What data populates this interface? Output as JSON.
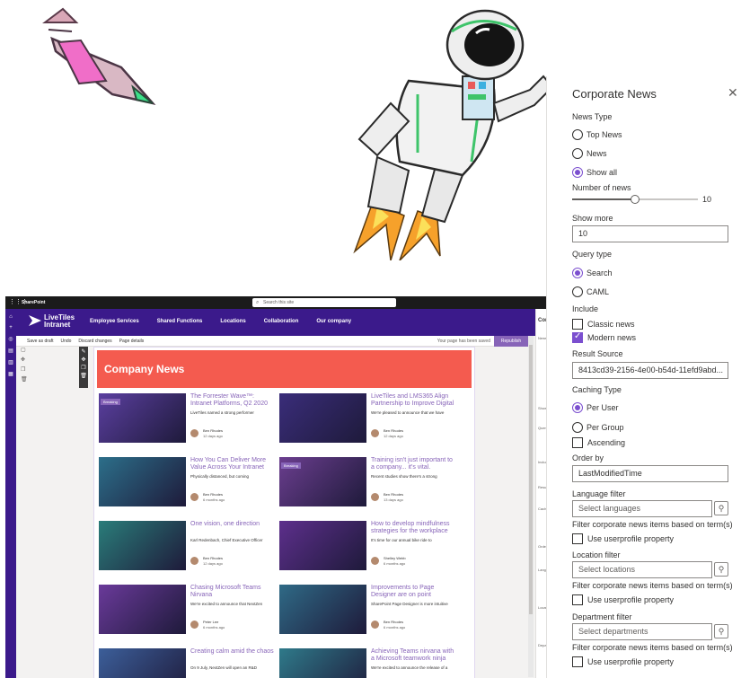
{
  "sharepoint": {
    "suite_brand": "SharePoint",
    "search_placeholder": "Search this site",
    "logo_text": "LiveTiles Intranet",
    "nav_items": [
      "Employee Services",
      "Shared Functions",
      "Locations",
      "Collaboration",
      "Our company"
    ],
    "command_bar": {
      "save_as_draft": "Save as draft",
      "undo": "Undo",
      "discard_changes": "Discard changes",
      "page_details": "Page details",
      "saved_status": "Your page has been saved",
      "republish": "Republish"
    },
    "news_heading": "Company News",
    "badge_breaking": "Breaking",
    "cards": [
      {
        "title": "The Forrester Wave™: Intranet Platforms, Q2 2020",
        "excerpt": "LiveTiles named a strong performer",
        "author": "Ben Rhodes",
        "date": "12 days ago",
        "breaking": true
      },
      {
        "title": "LiveTiles and LMS365 Align Partnership to Improve Digital",
        "excerpt": "We're pleased to announce that we have",
        "author": "Ben Rhodes",
        "date": "12 days ago",
        "breaking": false
      },
      {
        "title": "How You Can Deliver More Value Across Your Intranet",
        "excerpt": "Physically distanced, but coming",
        "author": "Ben Rhodes",
        "date": "6 months ago",
        "breaking": false
      },
      {
        "title": "Training isn't just important to a company... it's vital.",
        "excerpt": "Recent studies show there's a strong",
        "author": "Ben Rhodes",
        "date": "13 days ago",
        "breaking": true
      },
      {
        "title": "One vision, one direction",
        "excerpt": "Karl Redenbach, Chief Executive Officer",
        "author": "Ben Rhodes",
        "date": "12 days ago",
        "breaking": false
      },
      {
        "title": "How to develop mindfulness strategies for the workplace",
        "excerpt": "It's time for our annual bike ride to",
        "author": "Shelley Webb",
        "date": "6 months ago",
        "breaking": false
      },
      {
        "title": "Chasing Microsoft Teams Nirvana",
        "excerpt": "We're excited to announce that NextZen",
        "author": "Peter Lee",
        "date": "6 months ago",
        "breaking": false
      },
      {
        "title": "Improvements to Page Designer are on point",
        "excerpt": "SharePoint Page Designer is more intuitive",
        "author": "Ben Rhodes",
        "date": "6 months ago",
        "breaking": false
      },
      {
        "title": "Creating calm amid the chaos",
        "excerpt": "On 9 July, NextZen will open an R&D",
        "author": "",
        "date": "",
        "breaking": false
      },
      {
        "title": "Achieving Teams nirvana with a Microsoft teamwork ninja",
        "excerpt": "We're excited to announce the release of a",
        "author": "",
        "date": "",
        "breaking": false
      }
    ],
    "thumb_colors": [
      "#5b3fa0",
      "#3a2d7a",
      "#2c6f8a",
      "#6b3e8f",
      "#2a7d7a",
      "#5d2f8c",
      "#6a3a9a",
      "#2f6a86",
      "#3c5f9a",
      "#2f7a8a"
    ]
  },
  "pane": {
    "title": "Corporate News",
    "news_type_label": "News Type",
    "news_type_options": [
      "Top News",
      "News",
      "Show all"
    ],
    "news_type_selected": "Show all",
    "number_of_news_label": "Number of news",
    "number_of_news_value": 10,
    "number_of_news_max": 20,
    "show_more_label": "Show more",
    "show_more_value": "10",
    "query_type_label": "Query type",
    "query_type_options": [
      "Search",
      "CAML"
    ],
    "query_type_selected": "Search",
    "include_label": "Include",
    "include_options": [
      {
        "label": "Classic news",
        "checked": false
      },
      {
        "label": "Modern news",
        "checked": true
      }
    ],
    "result_source_label": "Result Source",
    "result_source_value": "8413cd39-2156-4e00-b54d-11efd9abd...",
    "caching_type_label": "Caching Type",
    "caching_options": [
      "Per User",
      "Per Group"
    ],
    "caching_selected": "Per User",
    "ascending_label": "Ascending",
    "order_by_label": "Order by",
    "order_by_value": "LastModifiedTime",
    "language_filter_label": "Language filter",
    "language_placeholder": "Select languages",
    "filter_note": "Filter corporate news items based on term(s)",
    "use_userprofile_label": "Use userprofile property",
    "location_filter_label": "Location filter",
    "location_placeholder": "Select locations",
    "department_filter_label": "Department filter",
    "department_placeholder": "Select departments",
    "accent_color": "#7b4fcf"
  },
  "colors": {
    "suite_purple": "#3b1a8b",
    "news_banner": "#f45b4f",
    "title_purple": "#8764b8"
  }
}
